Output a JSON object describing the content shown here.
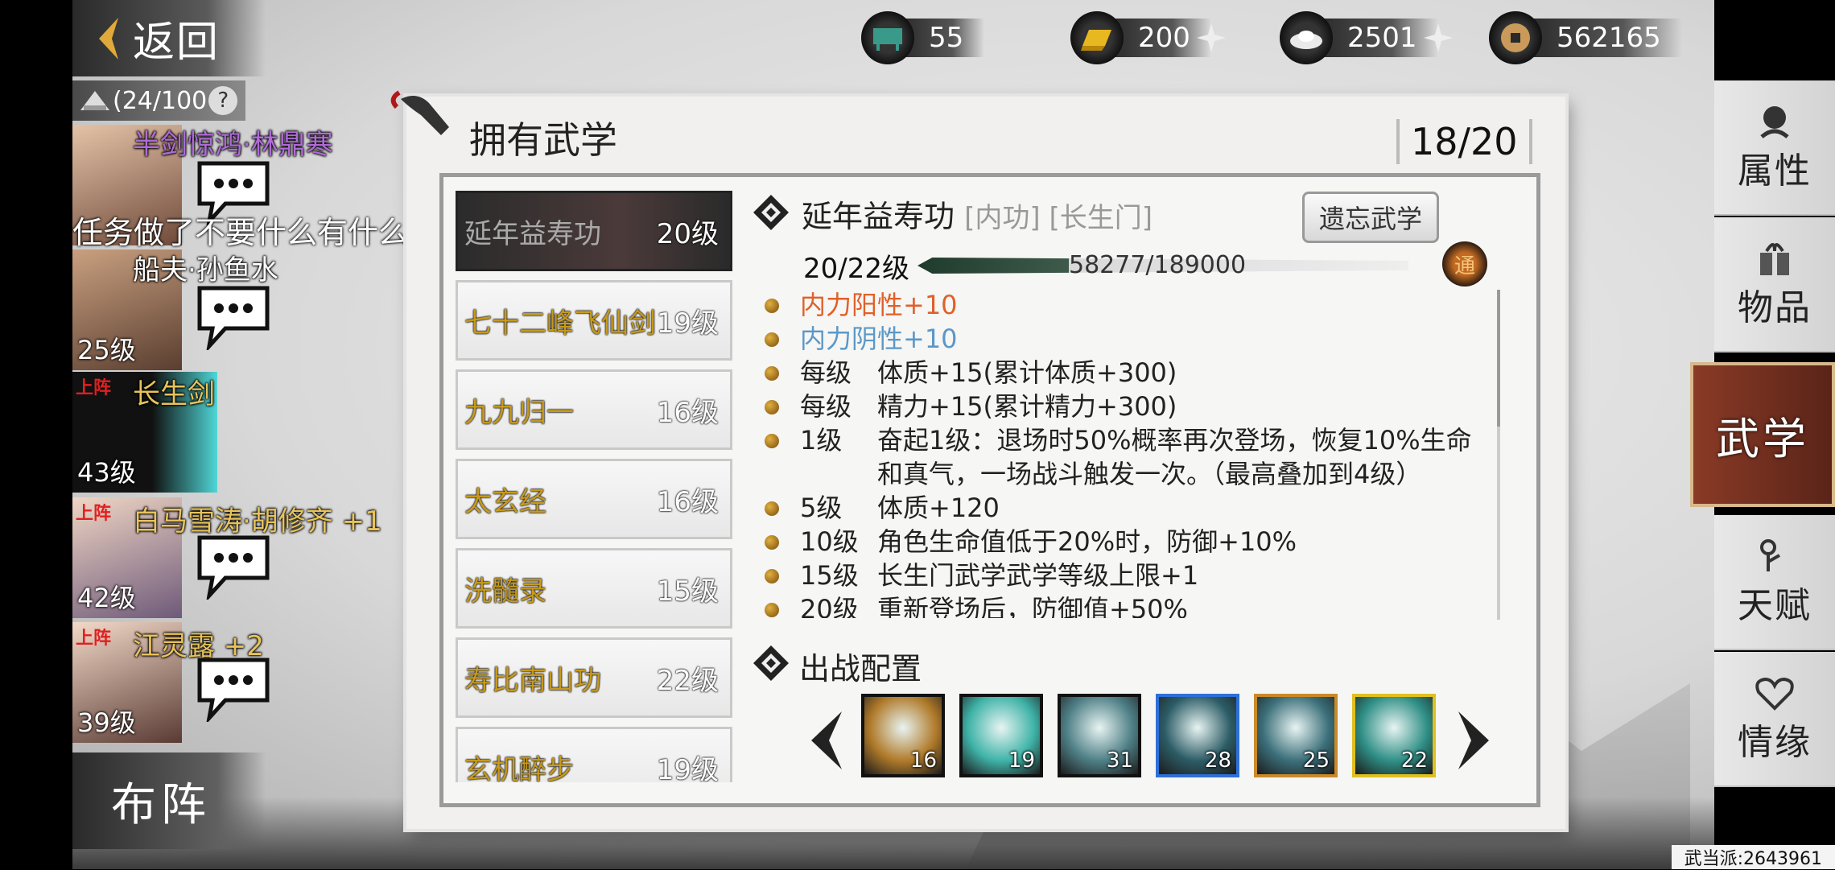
{
  "header": {
    "back_label": "返回",
    "resources": [
      {
        "icon": "stamina-icon",
        "value": "55",
        "has_plus": false
      },
      {
        "icon": "gold-bar-icon",
        "value": "200",
        "has_plus": true
      },
      {
        "icon": "silver-ingot-icon",
        "value": "2501",
        "has_plus": true
      },
      {
        "icon": "copper-coin-icon",
        "value": "562165",
        "has_plus": false
      }
    ]
  },
  "roster": {
    "capacity": "(24/100",
    "help": "?",
    "chat_message": "任务做了不要什么有什么嘛",
    "heroes": [
      {
        "name": "半剑惊鸿·林鼎寒",
        "level": "",
        "on_field": "",
        "name_color": "#b06ad8"
      },
      {
        "name": "船夫·孙鱼水",
        "level": "25级",
        "on_field": "",
        "name_color": "#ffffff"
      },
      {
        "name": "长生剑",
        "level": "43级",
        "on_field": "上阵",
        "name_color": "#e8c35a"
      },
      {
        "name": "白马雪涛·胡修齐 +1",
        "level": "42级",
        "on_field": "上阵",
        "name_color": "#e8c35a"
      },
      {
        "name": "江灵露 +2",
        "level": "39级",
        "on_field": "上阵",
        "name_color": "#e8c35a"
      }
    ],
    "formation_label": "布阵"
  },
  "panel": {
    "title": "拥有武学",
    "count": "18/20",
    "skills": [
      {
        "name": "延年益寿功",
        "level": "20级",
        "active": true
      },
      {
        "name": "七十二峰飞仙剑",
        "level": "19级",
        "active": false
      },
      {
        "name": "九九归一",
        "level": "16级",
        "active": false
      },
      {
        "name": "太玄经",
        "level": "16级",
        "active": false
      },
      {
        "name": "洗髓录",
        "level": "15级",
        "active": false
      },
      {
        "name": "寿比南山功",
        "level": "22级",
        "active": false
      },
      {
        "name": "玄机醉步",
        "level": "19级",
        "active": false
      }
    ]
  },
  "detail": {
    "name": "延年益寿功",
    "tags": "[内功] [长生门]",
    "forget_label": "遗忘武学",
    "level_text": "20/22级",
    "xp_text": "58277/189000",
    "xp_fraction": 0.308,
    "badge": "通",
    "effects": [
      {
        "key": "",
        "value": "内力阳性+10",
        "color": "#e0602a"
      },
      {
        "key": "",
        "value": "内力阴性+10",
        "color": "#5b98c8"
      },
      {
        "key": "每级",
        "value": "体质+15(累计体质+300)",
        "color": "#222222"
      },
      {
        "key": "每级",
        "value": "精力+15(累计精力+300)",
        "color": "#222222"
      },
      {
        "key": "1级",
        "value": "奋起1级：退场时50%概率再次登场，恢复10%生命和真气，一场战斗触发一次。（最高叠加到4级）",
        "color": "#222222"
      },
      {
        "key": "5级",
        "value": "体质+120",
        "color": "#222222"
      },
      {
        "key": "10级",
        "value": "角色生命值低于20%时，防御+10%",
        "color": "#222222"
      },
      {
        "key": "15级",
        "value": "长生门武学武学等级上限+1",
        "color": "#222222"
      },
      {
        "key": "20级",
        "value": "重新登场后，防御值+50%",
        "color": "#222222"
      }
    ],
    "deploy_title": "出战配置",
    "slots": [
      {
        "num": "16",
        "border": "#111111",
        "tint": "#b07a2a"
      },
      {
        "num": "19",
        "border": "#111111",
        "tint": "#3fb3a8"
      },
      {
        "num": "31",
        "border": "#111111",
        "tint": "#4e7f86"
      },
      {
        "num": "28",
        "border": "#2f6fd6",
        "tint": "#2c5c66"
      },
      {
        "num": "25",
        "border": "#c98a2a",
        "tint": "#3b6f7a"
      },
      {
        "num": "22",
        "border": "#e0c020",
        "tint": "#2f8f86"
      }
    ]
  },
  "right_nav": {
    "items": [
      "属性",
      "物品",
      "武学",
      "天赋",
      "情缘"
    ],
    "active": "武学"
  },
  "footer": {
    "server_id": "武当派:2643961"
  }
}
